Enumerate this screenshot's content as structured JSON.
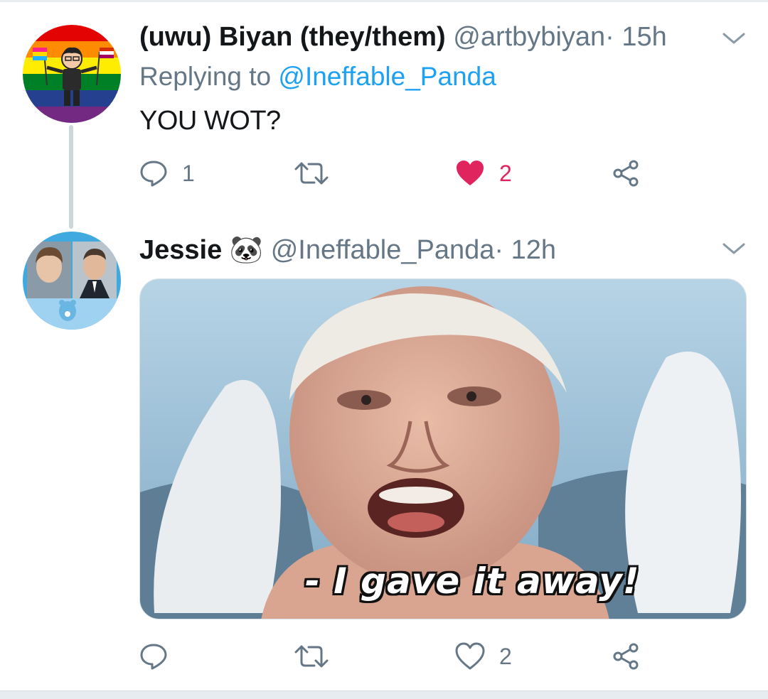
{
  "tweets": [
    {
      "display_name": "(uwu) Biyan (they/them)",
      "handle": "@artbybiyan",
      "separator": "·",
      "time": "15h",
      "replying_prefix": "Replying to",
      "replying_to": "@Ineffable_Panda",
      "text": "YOU WOT?",
      "reply_count": "1",
      "like_count": "2",
      "liked": true,
      "avatar": "rainbow-flag-cartoon-avatar"
    },
    {
      "display_name": "Jessie",
      "name_emoji": "🐼",
      "handle": "@Ineffable_Panda",
      "separator": "·",
      "time": "12h",
      "reply_count": "",
      "like_count": "2",
      "liked": false,
      "avatar": "two-photos-care-bear-avatar",
      "media_caption": "- I gave it away!"
    }
  ],
  "icons": {
    "reply": "reply-icon",
    "retweet": "retweet-icon",
    "like": "heart-icon",
    "share": "share-icon",
    "menu": "chevron-down-icon"
  },
  "colors": {
    "text": "#14171a",
    "secondary": "#657786",
    "link": "#1da1f2",
    "like_active": "#e0245e",
    "divider": "#e6ecf0"
  }
}
